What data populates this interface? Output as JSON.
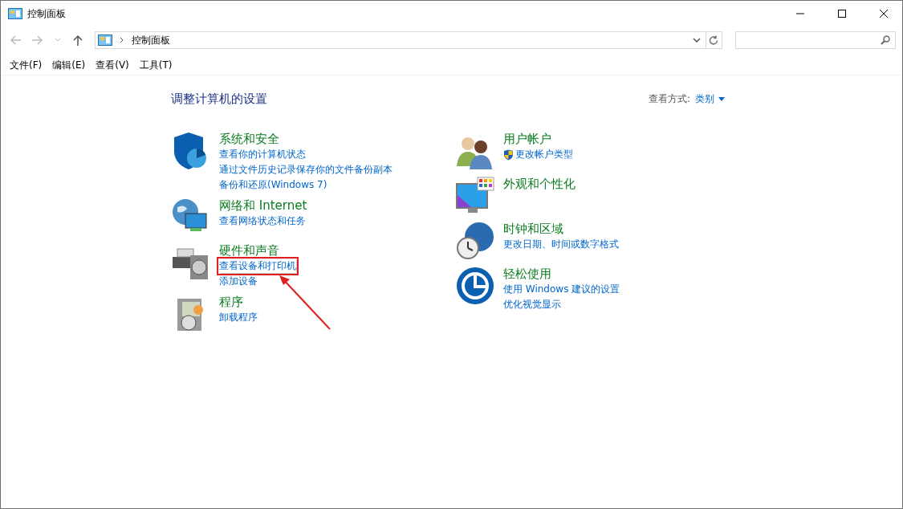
{
  "window": {
    "title": "控制面板"
  },
  "address": {
    "crumb": "控制面板"
  },
  "menu": [
    "文件(F)",
    "编辑(E)",
    "查看(V)",
    "工具(T)"
  ],
  "heading": "调整计算机的设置",
  "view_by": {
    "label": "查看方式:",
    "value": "类别"
  },
  "columns": [
    [
      {
        "kind": "shield",
        "title": "系统和安全",
        "links": [
          {
            "text": "查看你的计算机状态",
            "highlighted": false
          },
          {
            "text": "通过文件历史记录保存你的文件备份副本",
            "highlighted": false
          },
          {
            "text": "备份和还原(Windows 7)",
            "highlighted": false
          }
        ]
      },
      {
        "kind": "network",
        "title": "网络和 Internet",
        "links": [
          {
            "text": "查看网络状态和任务",
            "highlighted": false
          }
        ]
      },
      {
        "kind": "printer",
        "title": "硬件和声音",
        "links": [
          {
            "text": "查看设备和打印机",
            "highlighted": true
          },
          {
            "text": "添加设备",
            "highlighted": false
          }
        ]
      },
      {
        "kind": "programs",
        "title": "程序",
        "links": [
          {
            "text": "卸载程序",
            "highlighted": false
          }
        ]
      }
    ],
    [
      {
        "kind": "users",
        "title": "用户帐户",
        "links": [
          {
            "text": "更改帐户类型",
            "highlighted": false,
            "uac": true
          }
        ]
      },
      {
        "kind": "monitor",
        "title": "外观和个性化"
      },
      {
        "kind": "clock",
        "title": "时钟和区域",
        "links": [
          {
            "text": "更改日期、时间或数字格式",
            "highlighted": false
          }
        ]
      },
      {
        "kind": "access",
        "title": "轻松使用",
        "links": [
          {
            "text": "使用 Windows 建议的设置",
            "highlighted": false
          },
          {
            "text": "优化视觉显示",
            "highlighted": false
          }
        ]
      }
    ]
  ]
}
